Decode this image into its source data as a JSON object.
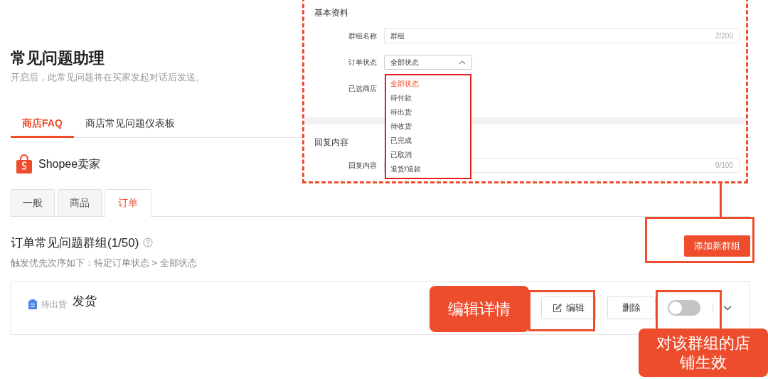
{
  "header": {
    "title": "常见问题助理",
    "subtitle": "开启后，此常见问题将在买家发起对话后发送。"
  },
  "main_tabs": [
    {
      "label": "商店FAQ",
      "selected": true
    },
    {
      "label": "商店常见问题仪表板",
      "selected": false
    }
  ],
  "shop": {
    "name": "Shopee卖家"
  },
  "category_tabs": [
    {
      "label": "一般",
      "selected": false
    },
    {
      "label": "商品",
      "selected": false
    },
    {
      "label": "订单",
      "selected": true
    }
  ],
  "group_section": {
    "title": "订单常见问题群组(1/50)",
    "note": "触发优先次序如下：特定订单状态 > 全部状态",
    "add_button": "添加新群组"
  },
  "groups": [
    {
      "status": "待出货",
      "name": "发货",
      "edit_button": "编辑",
      "delete_button": "删除",
      "on": false,
      "expanded": false
    }
  ],
  "inset": {
    "basic_title": "基本资料",
    "name_field": {
      "label": "群组名称",
      "value": "群组",
      "counter": "2/200"
    },
    "order_status": {
      "label": "订单状态",
      "value": "全部状态",
      "expanded": true,
      "options": [
        {
          "label": "全部状态",
          "selected": true
        },
        {
          "label": "待付款",
          "selected": false
        },
        {
          "label": "待出货",
          "selected": false
        },
        {
          "label": "待收货",
          "selected": false
        },
        {
          "label": "已完成",
          "selected": false
        },
        {
          "label": "已取消",
          "selected": false
        },
        {
          "label": "退货/退款",
          "selected": false
        }
      ]
    },
    "shop_label": "已选商店",
    "reply_title": "回复内容",
    "reply_field": {
      "label": "回复内容",
      "counter": "0/100"
    }
  },
  "callouts": [
    {
      "text": "编辑详情"
    },
    {
      "text": "对该群组的店铺生效"
    }
  ]
}
